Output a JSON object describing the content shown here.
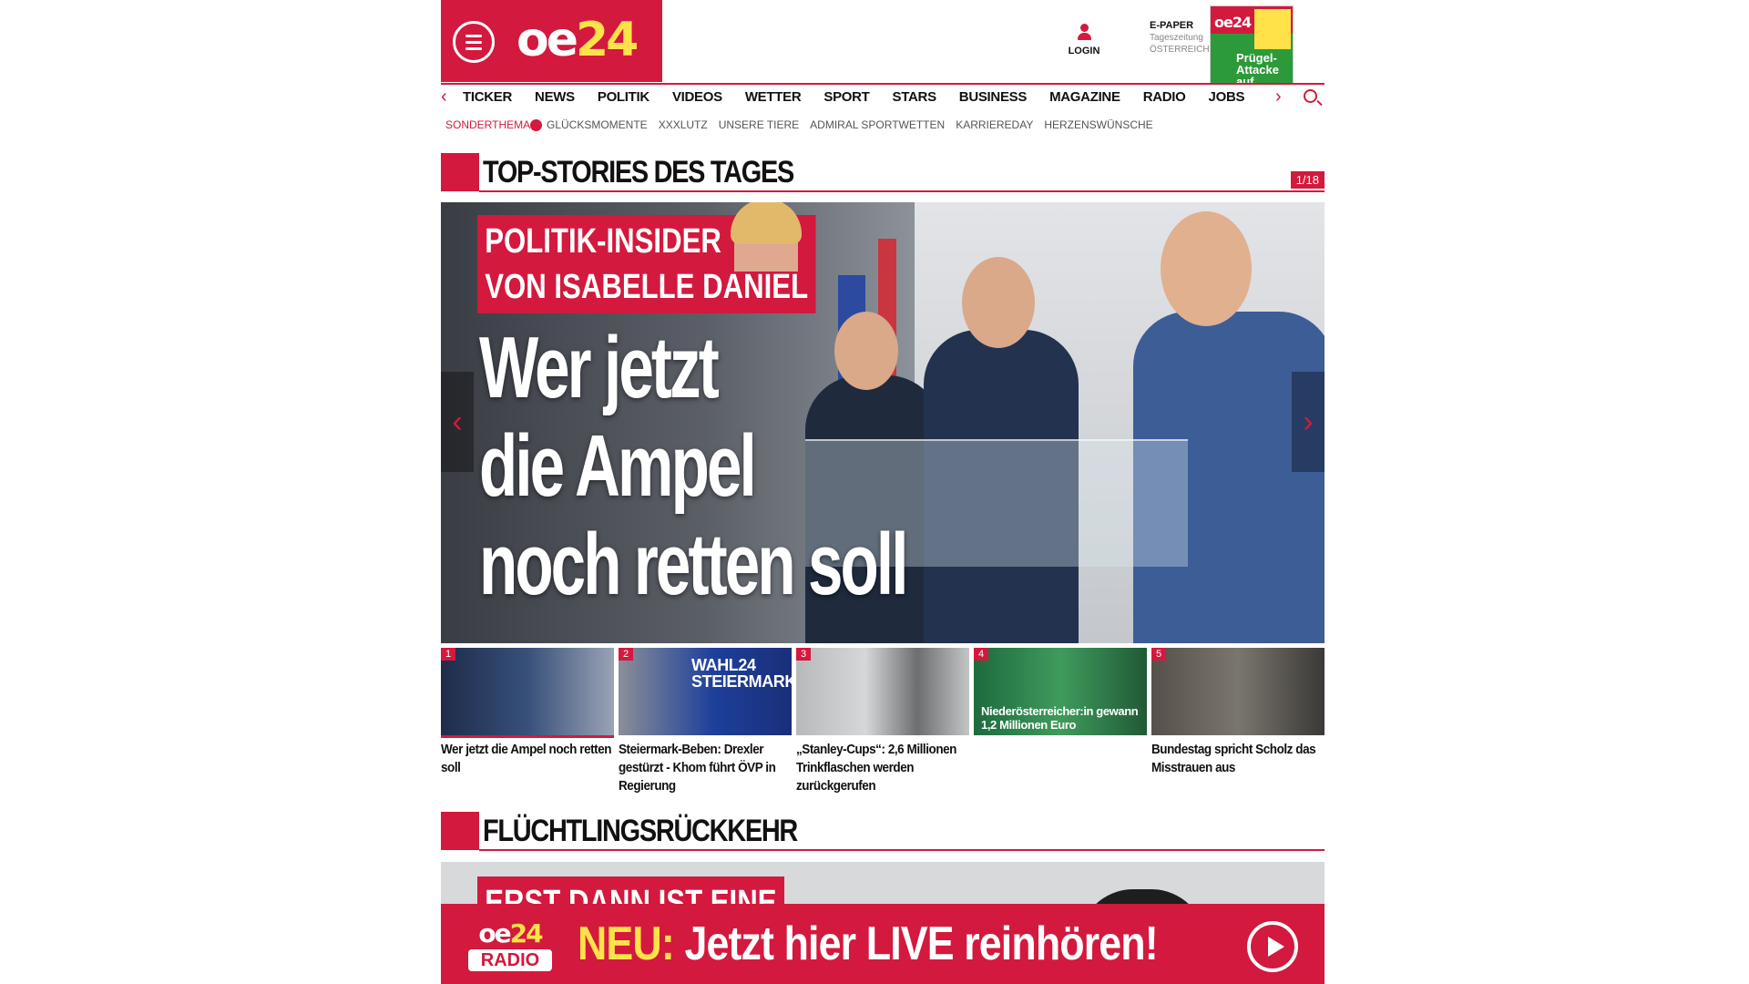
{
  "header": {
    "logo_text": "oe",
    "logo_num": "24",
    "login_label": "LOGIN",
    "epaper_title": "E-PAPER",
    "epaper_sub1": "Tageszeitung",
    "epaper_sub2": "ÖSTERREICH",
    "epaper_cover_logo": "oe24",
    "epaper_cover_headline": "Prügel-Attacke auf Rapid-Star"
  },
  "nav": {
    "left_arrow": "‹",
    "right_arrow": "›",
    "items": [
      "TICKER",
      "NEWS",
      "POLITIK",
      "VIDEOS",
      "WETTER",
      "SPORT",
      "STARS",
      "BUSINESS",
      "MAGAZINE",
      "RADIO",
      "JOBS"
    ]
  },
  "subnav": {
    "label": "SONDERTHEMA:",
    "items": [
      "GLÜCKSMOMENTE",
      "XXXLUTZ",
      "UNSERE TIERE",
      "ADMIRAL SPORTWETTEN",
      "KARRIEREDAY",
      "HERZENSWÜNSCHE"
    ]
  },
  "top_stories": {
    "title": "TOP-STORIES DES TAGES",
    "counter": "1/18",
    "hero": {
      "kicker_line1": "POLITIK-INSIDER",
      "kicker_line2": "VON ISABELLE DANIEL",
      "headline_line1": "Wer jetzt",
      "headline_line2": "die Ampel",
      "headline_line3": "noch retten soll",
      "prev": "‹",
      "next": "›"
    },
    "thumbs": [
      {
        "num": "1",
        "caption": "Wer jetzt die Ampel noch retten soll",
        "overlay": ""
      },
      {
        "num": "2",
        "caption": "Steiermark-Beben: Drexler gestürzt - Khom führt ÖVP in Regierung",
        "overlay": "WAHL24 STEIERMARK"
      },
      {
        "num": "3",
        "caption": "„Stanley-Cups“: 2,6 Millionen Trinkflaschen werden zurückgerufen",
        "overlay": ""
      },
      {
        "num": "4",
        "caption": "",
        "overlay": "Niederösterreicher:in gewann 1,2 Millionen Euro"
      },
      {
        "num": "5",
        "caption": "Bundestag spricht Scholz das Misstrauen aus",
        "overlay": ""
      }
    ]
  },
  "section2": {
    "title": "FLÜCHTLINGSRÜCKKEHR",
    "kicker": "ERST DANN IST EINE"
  },
  "radio_banner": {
    "logo_top": "oe",
    "logo_num": "24",
    "logo_bottom": "RADIO",
    "neu": "NEU:",
    "text": "Jetzt hier LIVE reinhören!"
  },
  "colors": {
    "brand": "#d3193d",
    "accent": "#ffe24a"
  }
}
